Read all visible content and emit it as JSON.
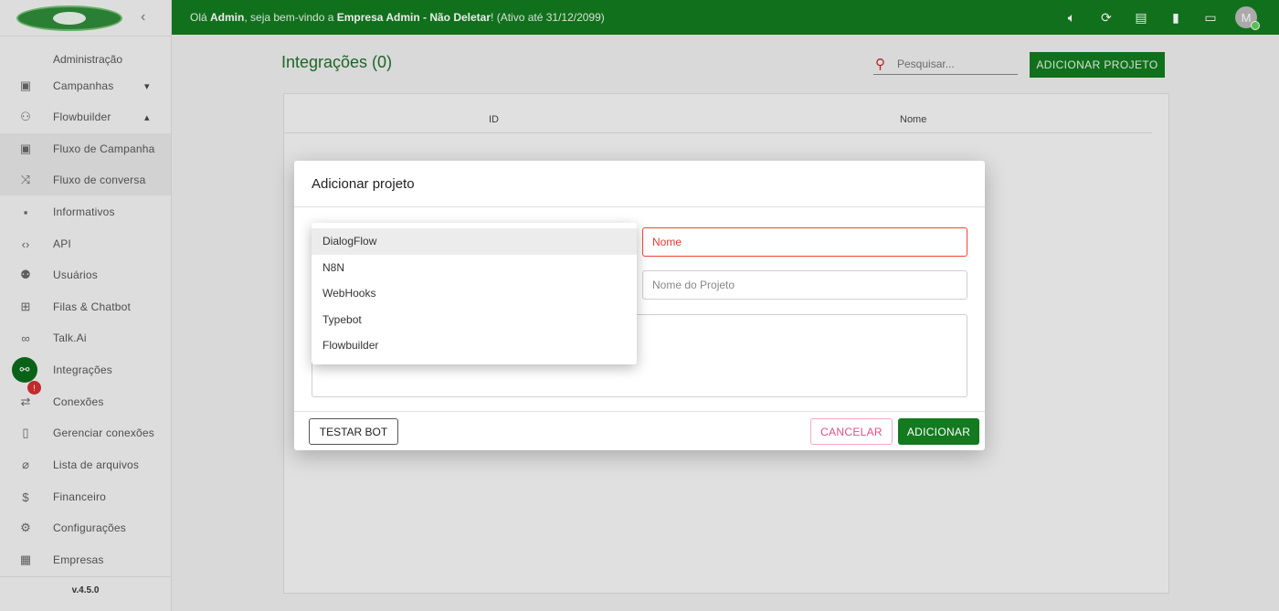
{
  "sidebar": {
    "section_label": "Administração",
    "items": [
      {
        "label": "Campanhas",
        "icon": "calendar-icon",
        "chevron": "▾"
      },
      {
        "label": "Flowbuilder",
        "icon": "share-icon",
        "chevron": "▴"
      },
      {
        "label": "Fluxo de Campanha",
        "icon": "calendar-icon"
      },
      {
        "label": "Fluxo de conversa",
        "icon": "shuffle-icon"
      },
      {
        "label": "Informativos",
        "icon": "announcement-icon"
      },
      {
        "label": "API",
        "icon": "code-icon"
      },
      {
        "label": "Usuários",
        "icon": "people-icon"
      },
      {
        "label": "Filas & Chatbot",
        "icon": "tree-icon"
      },
      {
        "label": "Talk.Ai",
        "icon": "infinity-icon"
      },
      {
        "label": "Integrações",
        "icon": "hub-icon"
      },
      {
        "label": "Conexões",
        "icon": "swap-icon",
        "badge": "!"
      },
      {
        "label": "Gerenciar conexões",
        "icon": "device-icon"
      },
      {
        "label": "Lista de arquivos",
        "icon": "attach-icon"
      },
      {
        "label": "Financeiro",
        "icon": "money-icon"
      },
      {
        "label": "Configurações",
        "icon": "gear-icon"
      },
      {
        "label": "Empresas",
        "icon": "building-icon"
      }
    ],
    "version": "v.4.5.0"
  },
  "topbar": {
    "greeting_prefix": "Olá ",
    "user": "Admin",
    "greeting_mid": ", seja bem-vindo a ",
    "company": "Empresa Admin - Não Deletar",
    "greeting_suffix": "! (Ativo até 31/12/2099)",
    "avatar_letter": "M"
  },
  "main": {
    "title": "Integrações (0)",
    "search_placeholder": "Pesquisar...",
    "add_button": "ADICIONAR PROJETO",
    "columns": [
      "ID",
      "Nome"
    ]
  },
  "modal": {
    "title": "Adicionar projeto",
    "name_placeholder": "Nome",
    "project_placeholder": "Nome do Projeto",
    "test_button": "TESTAR BOT",
    "cancel_button": "CANCELAR",
    "add_button": "ADICIONAR",
    "type_options": [
      "DialogFlow",
      "N8N",
      "WebHooks",
      "Typebot",
      "Flowbuilder"
    ],
    "selected_option": "DialogFlow"
  },
  "colors": {
    "primary": "#137a1f",
    "error": "#f44336",
    "cancel": "#e44d86"
  }
}
